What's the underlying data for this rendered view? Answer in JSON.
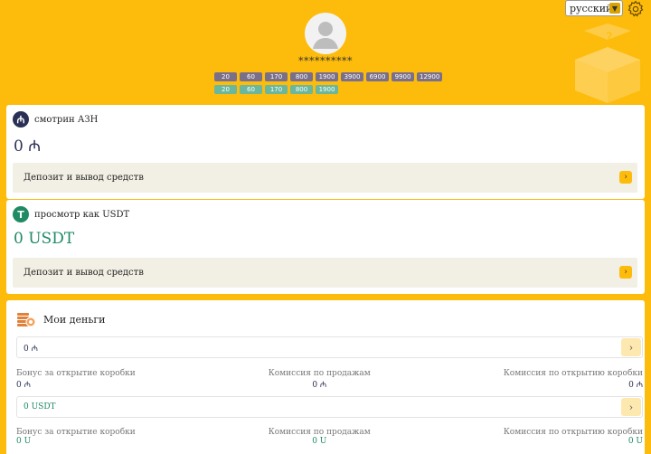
{
  "header": {
    "language": "русский",
    "username_masked": "**********"
  },
  "level_chips": {
    "row1": [
      "20",
      "60",
      "170",
      "800",
      "1900",
      "3900",
      "6900",
      "9900",
      "12900"
    ],
    "row2": [
      "20",
      "60",
      "170",
      "800",
      "1900"
    ]
  },
  "azn": {
    "title": "смотрин АЗН",
    "amount": "0 ₼",
    "deposit_label": "Депозит и вывод средств"
  },
  "usdt": {
    "title": "просмотр как USDT",
    "amount": "0 USDT",
    "deposit_label": "Депозит и вывод средств"
  },
  "money": {
    "title": "Мои деньги",
    "azn_row": "0 ₼",
    "usdt_row": "0 USDT",
    "stats_labels": [
      "Бонус за открытие коробки",
      "Комиссия по продажам",
      "Комиссия по открытию коробки"
    ],
    "azn_stats": [
      "0 ₼",
      "0 ₼",
      "0 ₼"
    ],
    "usdt_stats": [
      "0 U",
      "0 U",
      "0 U"
    ]
  },
  "colors": {
    "background": "#fdbb0b",
    "azn_accent": "#2a2f55",
    "usdt_accent": "#1f8a63"
  }
}
